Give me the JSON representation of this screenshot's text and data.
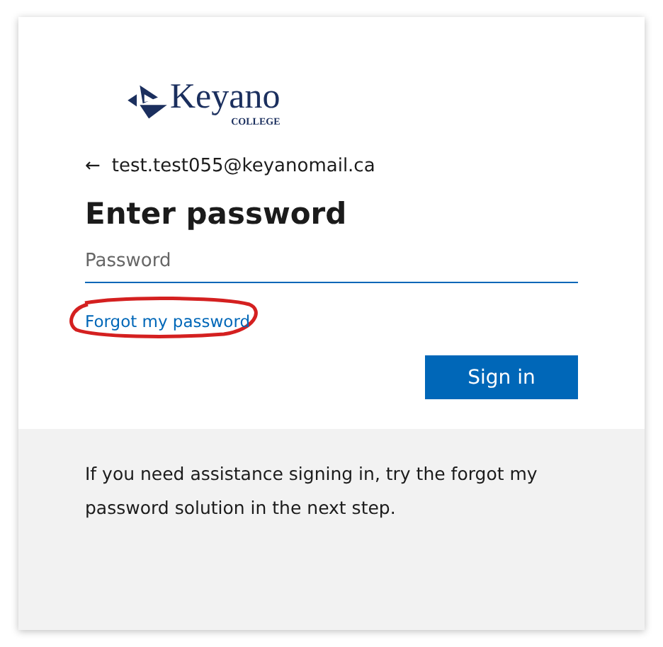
{
  "logo": {
    "name": "Keyano",
    "subtitle": "COLLEGE"
  },
  "back": {
    "arrow": "←",
    "email": "test.test055@keyanomail.ca"
  },
  "title": "Enter password",
  "password": {
    "placeholder": "Password"
  },
  "forgot_link": {
    "label": "Forgot my password",
    "circled": true
  },
  "buttons": [
    "Sign in"
  ],
  "footer": "If you need assistance signing in, try the forgot my password solution in the next step."
}
